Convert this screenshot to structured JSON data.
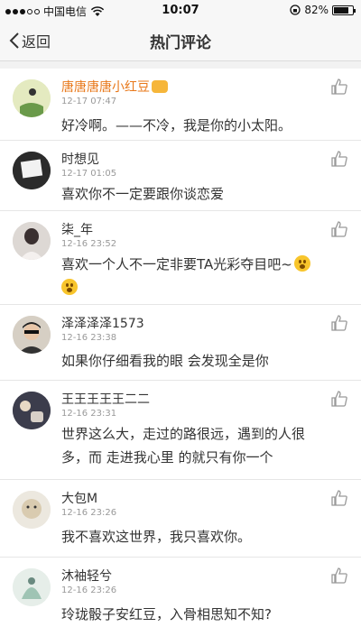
{
  "status": {
    "carrier": "中国电信",
    "time": "10:07",
    "battery": "82%",
    "battery_level": 0.82
  },
  "nav": {
    "back_label": "返回",
    "title": "热门评论"
  },
  "comments": [
    {
      "name": "唐唐唐唐小红豆",
      "time": "12-17 07:47",
      "lines": [
        "好冷啊。——不冷，我是你的小太阳。"
      ]
    },
    {
      "name": "时想见",
      "time": "12-17 01:05",
      "lines": [
        "喜欢你不一定要跟你谈恋爱"
      ]
    },
    {
      "name": "柒_年",
      "time": "12-16 23:52",
      "lines": [
        "喜欢一个人不一定非要TA光彩夺目吧~"
      ]
    },
    {
      "name": "泽泽泽泽1573",
      "time": "12-16 23:38",
      "lines": [
        "如果你仔细看我的眼 会发现全是你"
      ]
    },
    {
      "name": "王王王王王二二",
      "time": "12-16 23:31",
      "lines": [
        "世界这么大，走过的路很远，遇到的人很",
        "多，而 走进我心里 的就只有你一个"
      ]
    },
    {
      "name": "大包M",
      "time": "12-16 23:26",
      "lines": [
        "我不喜欢这世界，我只喜欢你。"
      ]
    },
    {
      "name": "沐袖轻兮",
      "time": "12-16 23:26",
      "lines": [
        "玲珑骰子安红豆，入骨相思知不知?"
      ]
    }
  ],
  "colors": {
    "highlight_name": "#e8781a",
    "time": "#999999",
    "background": "#f2f2f2"
  }
}
